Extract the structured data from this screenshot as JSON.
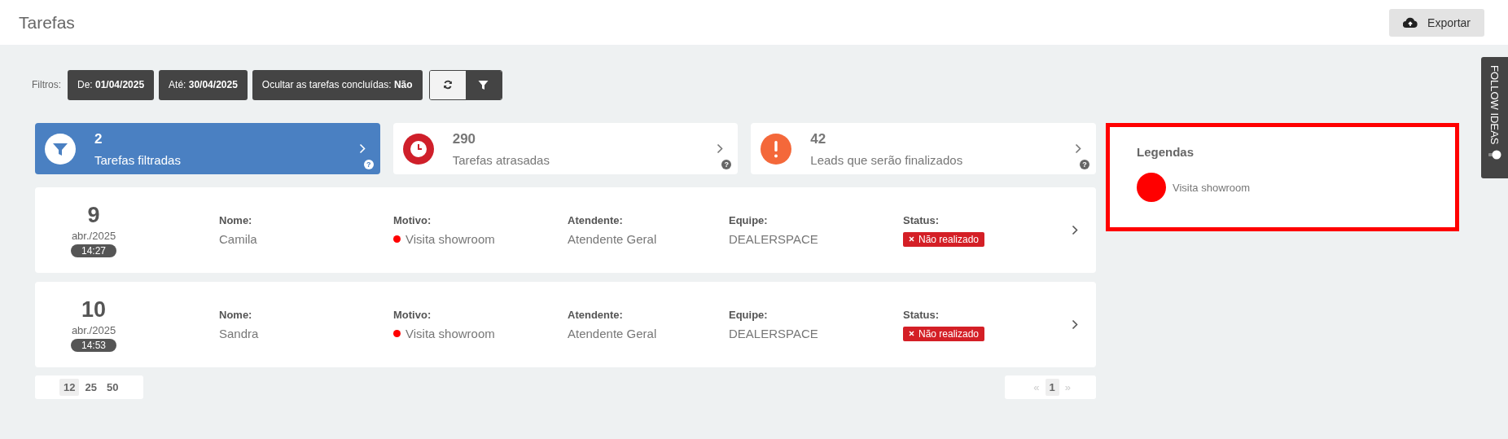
{
  "header": {
    "title": "Tarefas",
    "export_button": "Exportar"
  },
  "filters": {
    "label": "Filtros:",
    "chips": [
      {
        "label": "De:",
        "value": "01/04/2025"
      },
      {
        "label": "Até:",
        "value": "30/04/2025"
      },
      {
        "label": "Ocultar as tarefas concluídas:",
        "value": "Não"
      }
    ],
    "actions": [
      {
        "kind": "refresh"
      },
      {
        "kind": "filter"
      }
    ]
  },
  "summary_cards": [
    {
      "kind": "filter",
      "count": "2",
      "label": "Tarefas filtradas",
      "selected": true,
      "help": "?"
    },
    {
      "kind": "clock",
      "count": "290",
      "label": "Tarefas atrasadas",
      "selected": false,
      "help": "?"
    },
    {
      "kind": "alert",
      "count": "42",
      "label": "Leads que serão finalizados",
      "selected": false,
      "help": "?"
    }
  ],
  "tasks": [
    {
      "day": "9",
      "month": "abr./2025",
      "time": "14:27",
      "fields": [
        {
          "label": "Nome:",
          "value": "Camila"
        },
        {
          "label": "Motivo:",
          "value": "Visita showroom",
          "color": "#ff0000"
        },
        {
          "label": "Atendente:",
          "value": "Atendente Geral"
        },
        {
          "label": "Equipe:",
          "value": "DEALERSPACE"
        }
      ],
      "status_label": "Status:",
      "status": "Não realizado"
    },
    {
      "day": "10",
      "month": "abr./2025",
      "time": "14:53",
      "fields": [
        {
          "label": "Nome:",
          "value": "Sandra"
        },
        {
          "label": "Motivo:",
          "value": "Visita showroom",
          "color": "#ff0000"
        },
        {
          "label": "Atendente:",
          "value": "Atendente Geral"
        },
        {
          "label": "Equipe:",
          "value": "DEALERSPACE"
        }
      ],
      "status_label": "Status:",
      "status": "Não realizado"
    }
  ],
  "page_sizes": [
    {
      "label": "12",
      "selected": true
    },
    {
      "label": "25",
      "selected": false
    },
    {
      "label": "50",
      "selected": false
    }
  ],
  "pagination": {
    "prev": "«",
    "pages": [
      {
        "label": "1",
        "selected": true
      }
    ],
    "next": "»"
  },
  "legend": {
    "title": "Legendas",
    "items": [
      {
        "label": "Visita showroom",
        "color": "#ff0000"
      }
    ]
  },
  "side_tab": {
    "label": "FOLLOW IDEAS"
  }
}
